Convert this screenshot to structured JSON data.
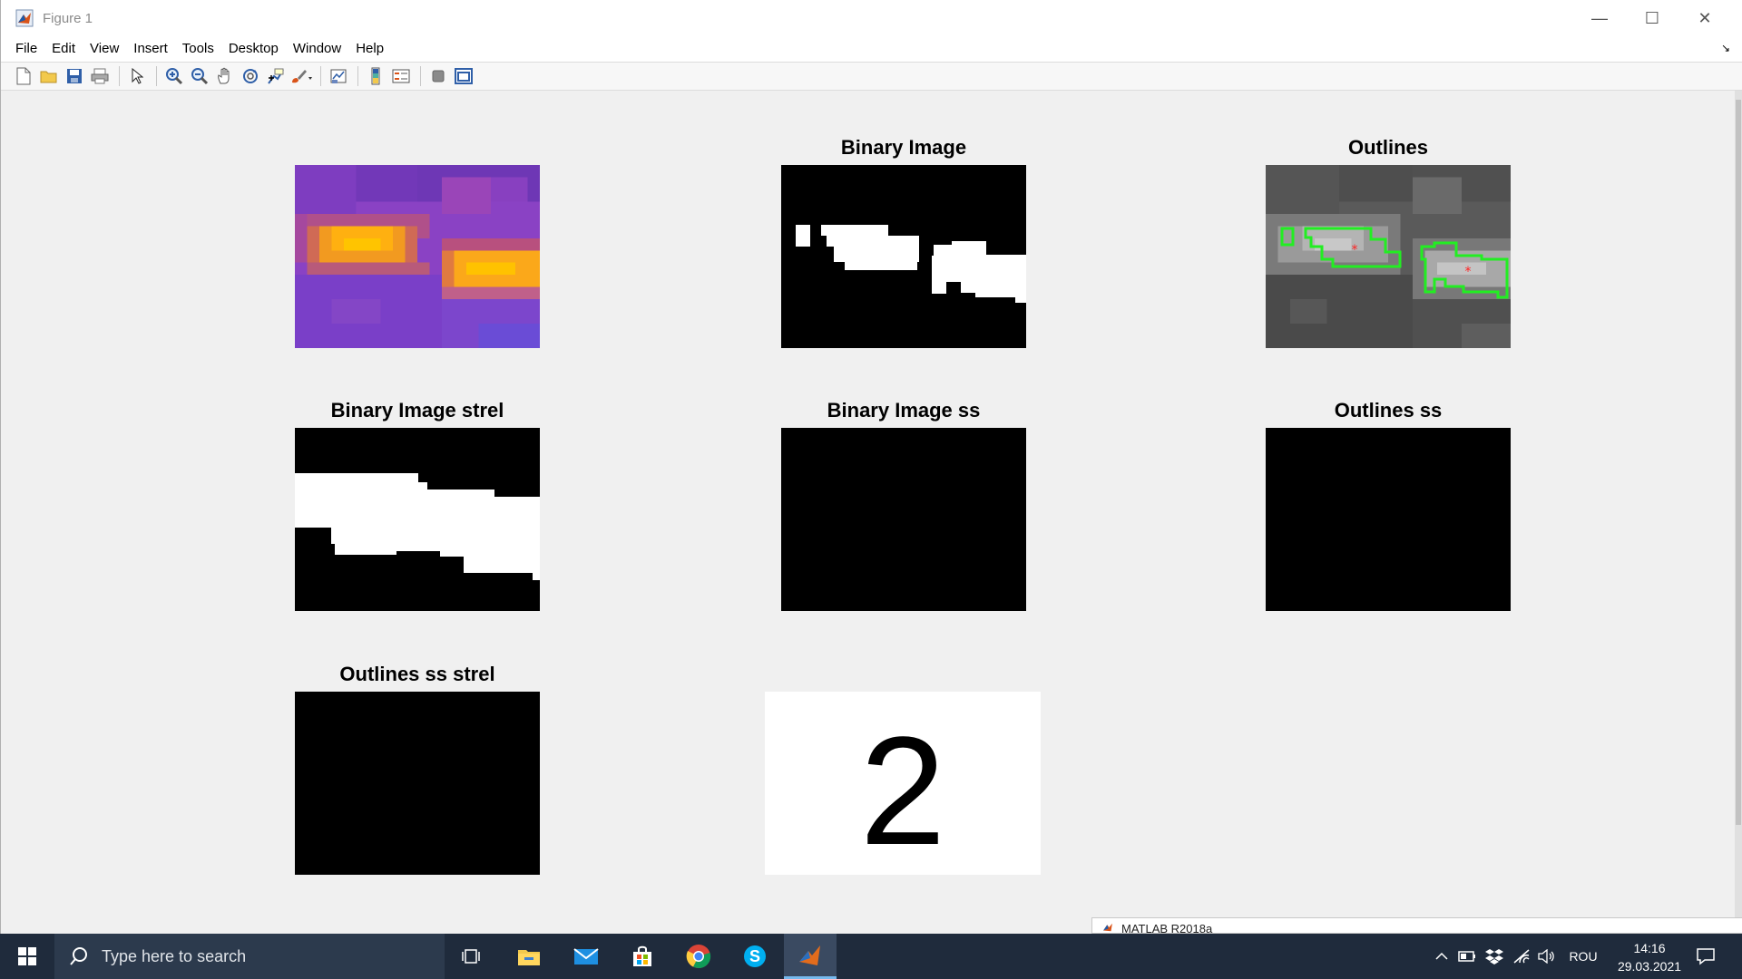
{
  "window": {
    "title": "Figure 1",
    "controls": {
      "minimize": "—",
      "maximize": "☐",
      "close": "✕"
    }
  },
  "menu": [
    "File",
    "Edit",
    "View",
    "Insert",
    "Tools",
    "Desktop",
    "Window",
    "Help"
  ],
  "toolbar": {
    "icons": [
      "new-figure-icon",
      "open-file-icon",
      "save-icon",
      "print-icon",
      "edit-plot-arrow-icon",
      "zoom-in-icon",
      "zoom-out-icon",
      "pan-hand-icon",
      "rotate-3d-icon",
      "data-cursor-icon",
      "brush-icon",
      "link-plot-icon",
      "colorbar-icon",
      "legend-icon",
      "hide-plot-tools-icon",
      "show-plot-tools-icon"
    ]
  },
  "subplots": {
    "s1": {
      "title": ""
    },
    "s2": {
      "title": "Binary Image"
    },
    "s3": {
      "title": "Outlines"
    },
    "s4": {
      "title": "Binary Image strel"
    },
    "s5": {
      "title": "Binary Image ss"
    },
    "s6": {
      "title": "Outlines ss"
    },
    "s7": {
      "title": "Outlines ss strel"
    },
    "s8": {
      "title": "",
      "digit": "2"
    }
  },
  "colors": {
    "outline": "#22ee22",
    "centroid": "#ff2222",
    "thermal_low": "#7a2fc0",
    "thermal_high": "#ffb000"
  },
  "background_window": {
    "label": "MATLAB R2018a"
  },
  "taskbar": {
    "search_placeholder": "Type here to search",
    "apps": [
      "task-view-icon",
      "file-explorer-icon",
      "mail-icon",
      "store-icon",
      "chrome-icon",
      "skype-icon",
      "matlab-icon"
    ],
    "tray": {
      "language": "ROU"
    },
    "clock": {
      "time": "14:16",
      "date": "29.03.2021"
    }
  }
}
